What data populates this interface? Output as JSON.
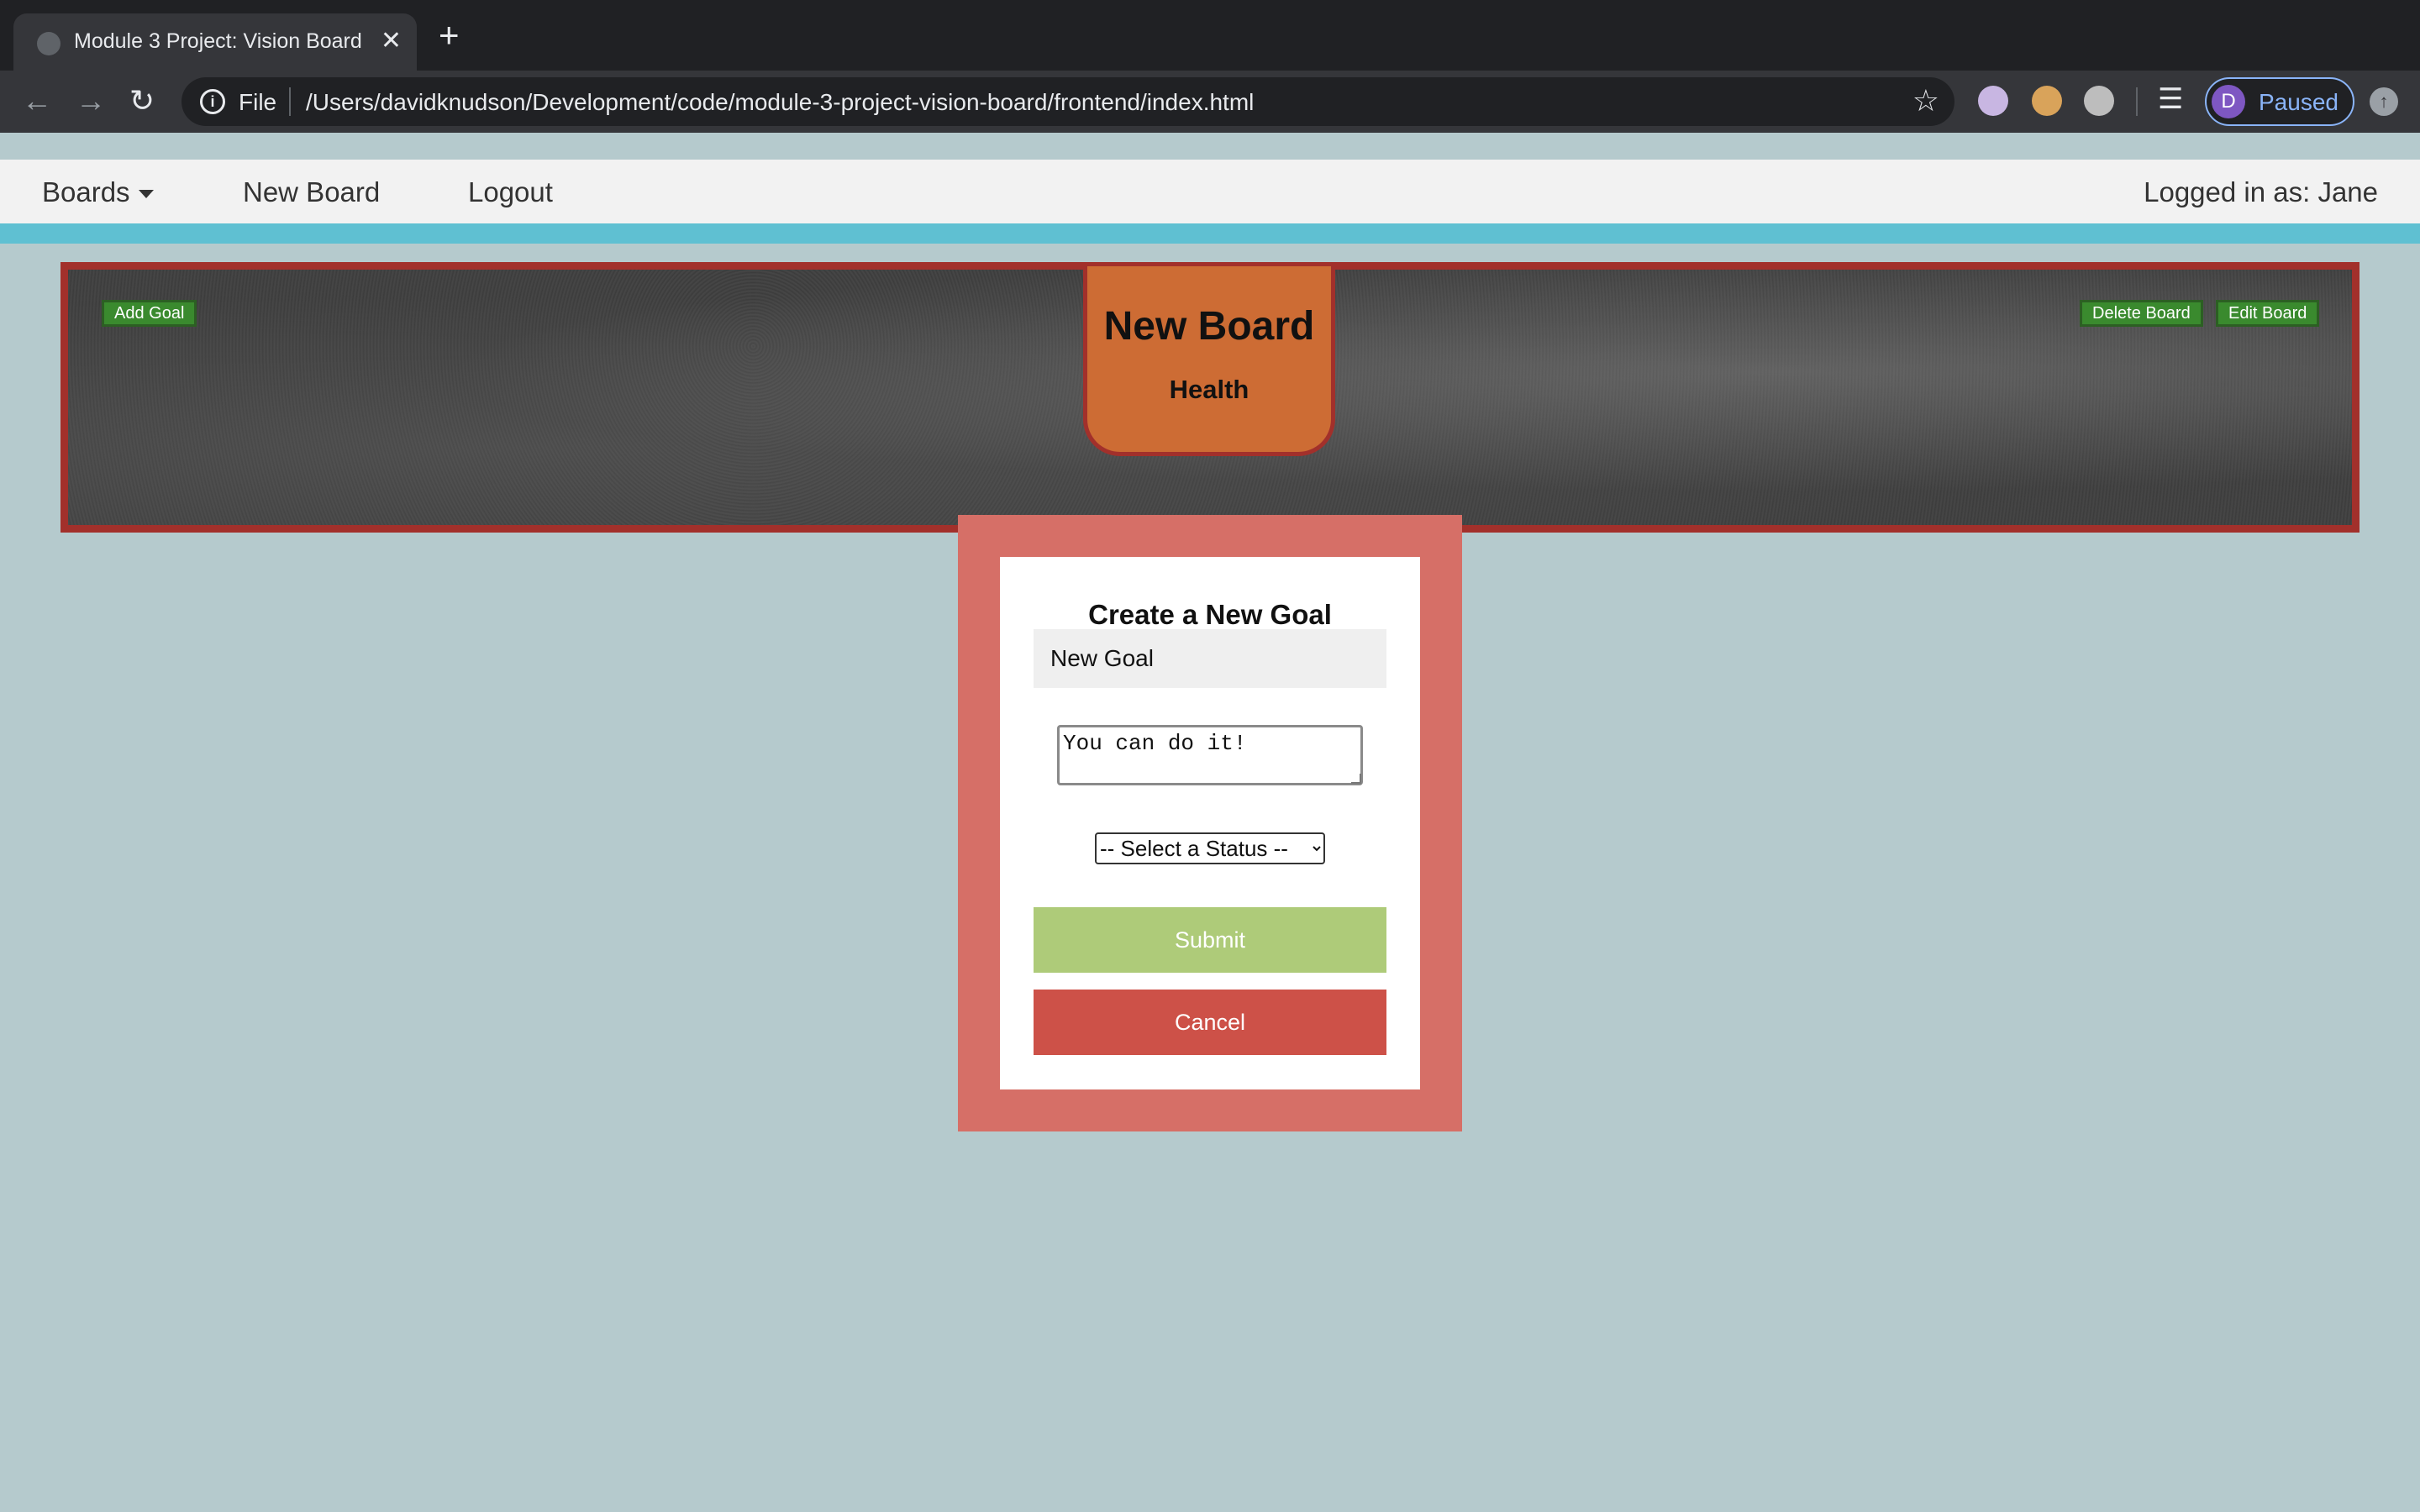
{
  "browser": {
    "tab_title": "Module 3 Project: Vision Board",
    "tab_close": "✕",
    "new_tab": "+",
    "url_scheme": "File",
    "url": "/Users/davidknudson/Development/code/module-3-project-vision-board/frontend/index.html",
    "profile_initial": "D",
    "profile_status": "Paused",
    "icons": [
      "back-icon",
      "forward-icon",
      "reload-icon",
      "info-icon",
      "star-icon",
      "extension-icon",
      "cookie-icon",
      "extension-icon",
      "playlist-icon",
      "update-icon"
    ]
  },
  "navbar": {
    "boards_label": "Boards",
    "new_board_label": "New Board",
    "logout_label": "Logout",
    "user_label": "Logged in as: Jane"
  },
  "board": {
    "title": "New Board",
    "category": "Health",
    "add_goal_label": "Add Goal",
    "delete_board_label": "Delete Board",
    "edit_board_label": "Edit Board"
  },
  "form": {
    "heading": "Create a New Goal",
    "title_value": "New Goal",
    "description_value": "You can do it!",
    "status_selected": "-- Select a Status --",
    "submit_label": "Submit",
    "cancel_label": "Cancel"
  },
  "colors": {
    "page_bg": "#b5cacd",
    "navbar_bg": "#f2f2f2",
    "navbar_accent": "#5fc0d2",
    "board_border": "#a2302b",
    "title_card": "#cd6c34",
    "modal_border": "#d66f67",
    "submit": "#aecb79",
    "cancel": "#cd5148",
    "small_button": "#3a8a2e"
  }
}
